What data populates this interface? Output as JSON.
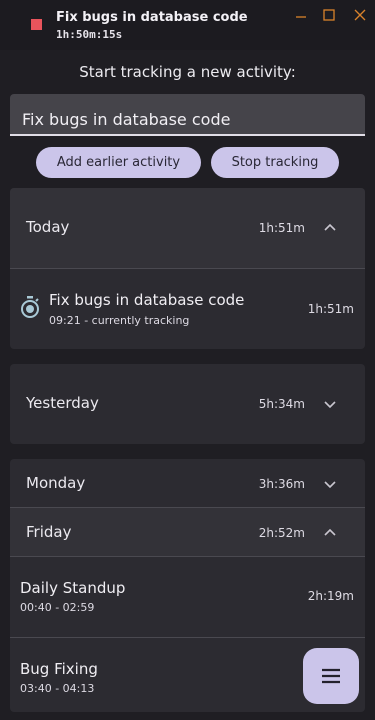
{
  "titlebar": {
    "title": "Fix bugs in database code",
    "timer": "1h:50m:15s",
    "icons": [
      "stop-square-icon",
      "minimize-icon",
      "maximize-icon",
      "close-icon"
    ]
  },
  "prompt": "Start tracking a new activity:",
  "activity_input": {
    "value": "Fix bugs in database code"
  },
  "buttons": {
    "add_earlier": "Add earlier activity",
    "stop": "Stop tracking"
  },
  "groups": [
    {
      "label": "Today",
      "total": "1h:51m",
      "expanded": true,
      "entries": [
        {
          "title": "Fix bugs in database code",
          "time": "09:21 - currently tracking",
          "duration": "1h:51m",
          "icon": "timer-icon"
        }
      ]
    },
    {
      "label": "Yesterday",
      "total": "5h:34m",
      "expanded": false
    },
    {
      "label": "Monday",
      "total": "3h:36m",
      "expanded": false
    },
    {
      "label": "Friday",
      "total": "2h:52m",
      "expanded": true,
      "entries": [
        {
          "title": "Daily Standup",
          "time": "00:40 - 02:59",
          "duration": "2h:19m"
        },
        {
          "title": "Bug Fixing",
          "time": "03:40 - 04:13",
          "duration": ""
        }
      ]
    }
  ],
  "fab": {
    "icon": "menu-icon"
  },
  "colors": {
    "accent": "#cbc5ea",
    "record": "#e9545c",
    "window_control": "#d9822b",
    "background": "#1f1e23"
  }
}
